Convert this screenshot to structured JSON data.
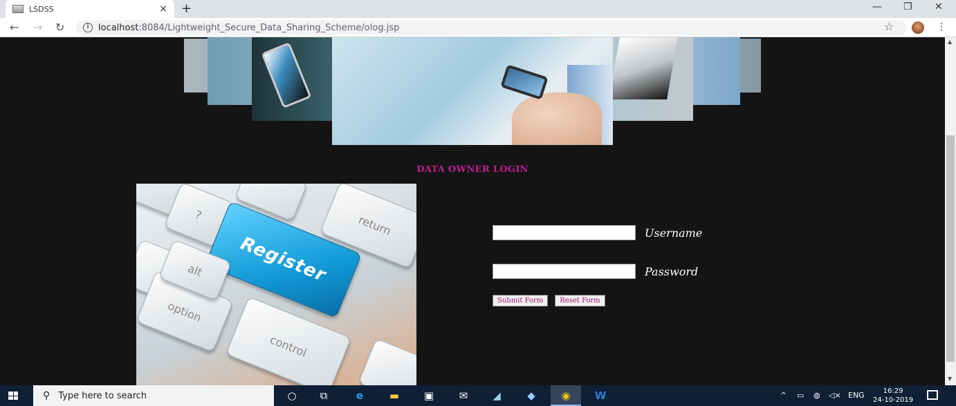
{
  "browser": {
    "tab_title": "LSDSS",
    "tab_close": "×",
    "new_tab": "+",
    "url_host": "localhost",
    "url_path": ":8084/Lightweight_Secure_Data_Sharing_Scheme/olog.jsp",
    "window_controls": [
      "—",
      "❐",
      "✕"
    ]
  },
  "page": {
    "heading": "DATA OWNER LOGIN",
    "keyboard_keys": {
      "register": "Register",
      "return": "return",
      "alt": "alt",
      "option": "option",
      "control": "control",
      "question": "?"
    },
    "form": {
      "username_label": "Username",
      "password_label": "Password",
      "username_value": "",
      "password_value": "",
      "submit_label": "Submit Form",
      "reset_label": "Reset Form"
    },
    "colors": {
      "heading": "#c21d8f",
      "background": "#141414",
      "button_text": "#a01670"
    }
  },
  "taskbar": {
    "search_placeholder": "Type here to search",
    "tray_lang": "ENG",
    "time": "16:29",
    "date": "24-10-2019",
    "tray_chevron": "^"
  }
}
